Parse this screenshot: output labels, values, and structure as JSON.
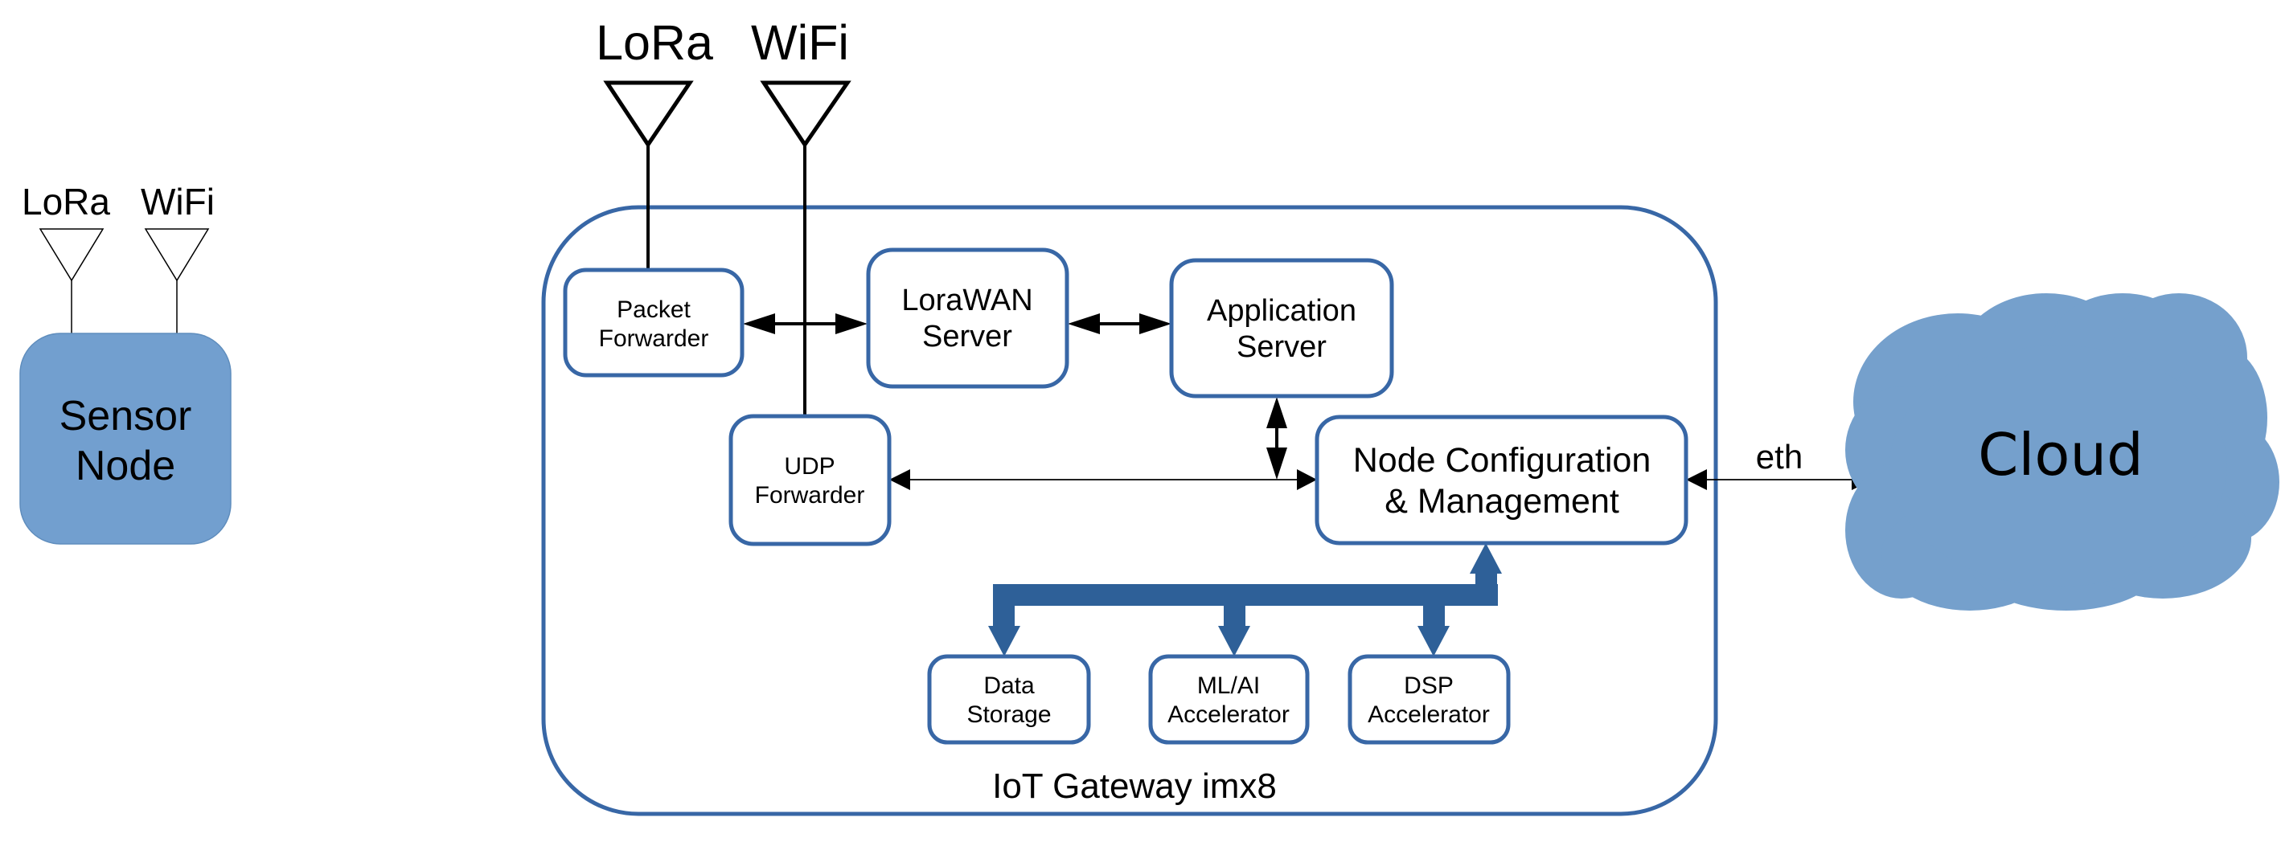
{
  "colors": {
    "box_border": "#3867a6",
    "sensor_fill": "#729fcf",
    "cloud_fill": "#75a0cc",
    "bus": "#2e6098",
    "text": "#000000"
  },
  "sensor_node": {
    "label_line1": "Sensor",
    "label_line2": "Node",
    "antennas": [
      {
        "label": "LoRa",
        "icon": "antenna-icon"
      },
      {
        "label": "WiFi",
        "icon": "antenna-icon"
      }
    ]
  },
  "gateway": {
    "title": "IoT Gateway imx8",
    "antennas": [
      {
        "label": "LoRa",
        "icon": "antenna-icon"
      },
      {
        "label": "WiFi",
        "icon": "antenna-icon"
      }
    ],
    "blocks": {
      "packet_forwarder": {
        "line1": "Packet",
        "line2": "Forwarder"
      },
      "lorawan_server": {
        "line1": "LoraWAN",
        "line2": "Server"
      },
      "application_server": {
        "line1": "Application",
        "line2": "Server"
      },
      "udp_forwarder": {
        "line1": "UDP",
        "line2": "Forwarder"
      },
      "node_config": {
        "line1": "Node Configuration",
        "line2": "& Management"
      },
      "data_storage": {
        "line1": "Data",
        "line2": "Storage"
      },
      "ml_ai": {
        "line1": "ML/AI",
        "line2": "Accelerator"
      },
      "dsp": {
        "line1": "DSP",
        "line2": "Accelerator"
      }
    }
  },
  "links": {
    "eth_label": "eth"
  },
  "cloud": {
    "label": "Cloud"
  }
}
